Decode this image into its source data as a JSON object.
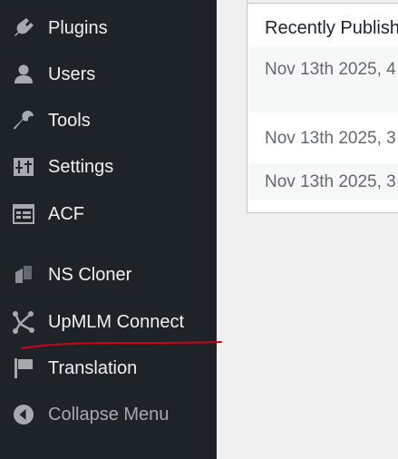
{
  "sidebar": {
    "items": [
      {
        "label": "Plugins",
        "icon": "plugin-icon"
      },
      {
        "label": "Users",
        "icon": "user-icon"
      },
      {
        "label": "Tools",
        "icon": "wrench-icon"
      },
      {
        "label": "Settings",
        "icon": "sliders-icon"
      },
      {
        "label": "ACF",
        "icon": "table-icon"
      },
      {
        "label": "NS Cloner",
        "icon": "cloner-icon"
      },
      {
        "label": "UpMLM Connect",
        "icon": "network-icon"
      },
      {
        "label": "Translation",
        "icon": "flag-icon"
      },
      {
        "label": "Collapse Menu",
        "icon": "collapse-arrow-icon"
      }
    ]
  },
  "widget": {
    "title": "Recently Publish",
    "rows": [
      "Nov 13th 2025, 4",
      "Nov 13th 2025, 3",
      "Nov 13th 2025, 3"
    ]
  },
  "colors": {
    "sidebar_bg": "#1d2327",
    "sidebar_text": "#f0f0f1",
    "icon_color": "#a7aaad",
    "annotation_red": "#d0021b",
    "page_bg": "#f0f0f1"
  }
}
